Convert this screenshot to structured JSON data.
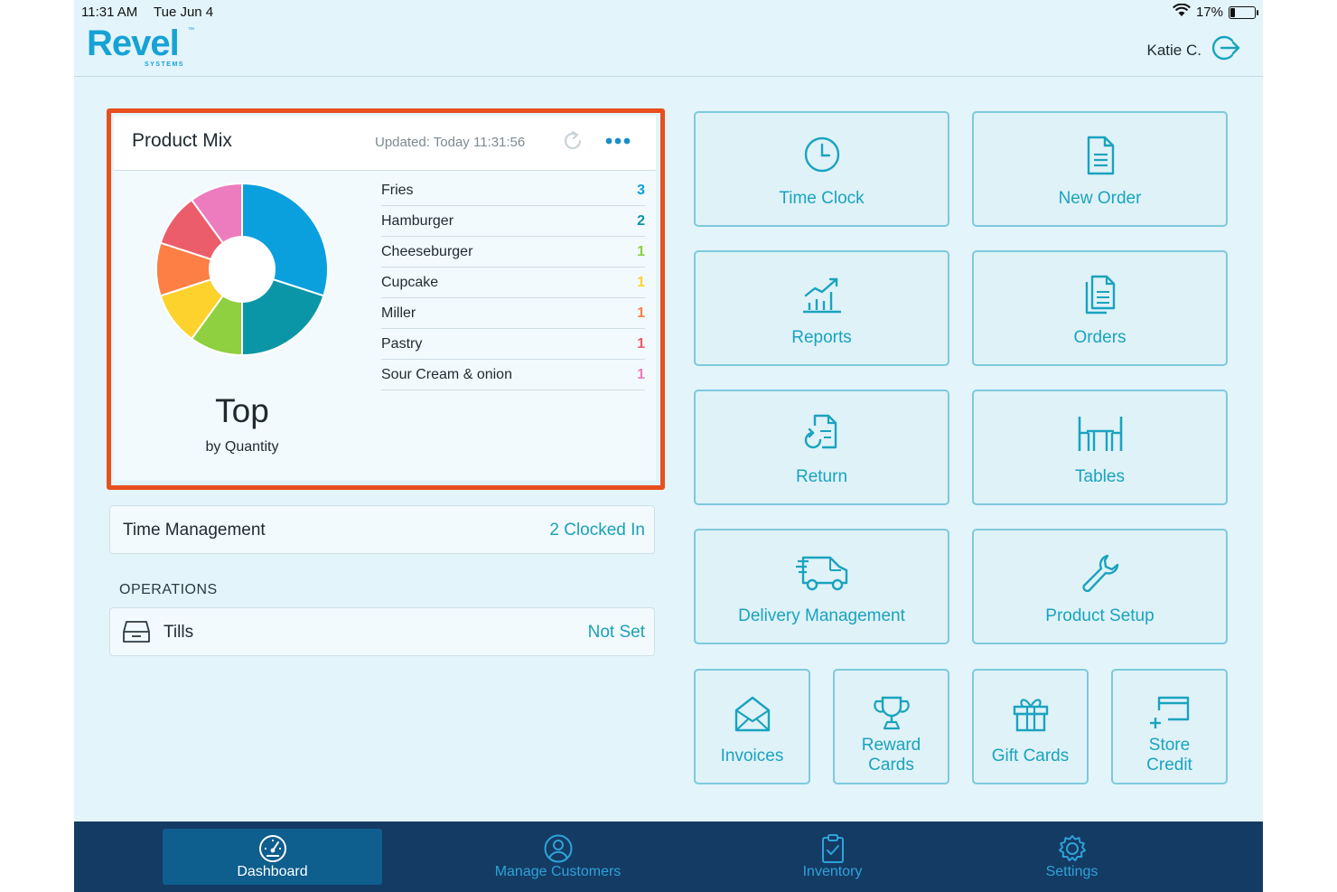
{
  "status_bar": {
    "time": "11:31 AM",
    "date": "Tue Jun 4",
    "battery": "17%",
    "battery_level": 0.17
  },
  "header": {
    "logo": "Revel",
    "logo_tm": "™",
    "logo_sub": "SYSTEMS",
    "user_name": "Katie C.",
    "logout_icon": "logout-icon"
  },
  "product_mix": {
    "title": "Product Mix",
    "updated": "Updated: Today 11:31:56",
    "top_label": "Top",
    "top_sub": "by Quantity",
    "items": [
      {
        "name": "Fries",
        "qty": "3",
        "color": "#0aa0de"
      },
      {
        "name": "Hamburger",
        "qty": "2",
        "color": "#0a96a6"
      },
      {
        "name": "Cheeseburger",
        "qty": "1",
        "color": "#8ed03f"
      },
      {
        "name": "Cupcake",
        "qty": "1",
        "color": "#fdd22c"
      },
      {
        "name": "Miller",
        "qty": "1",
        "color": "#fd7f45"
      },
      {
        "name": "Pastry",
        "qty": "1",
        "color": "#ec5d6b"
      },
      {
        "name": "Sour Cream & onion",
        "qty": "1",
        "color": "#ec7cbd"
      }
    ]
  },
  "time_management": {
    "label": "Time Management",
    "value": "2 Clocked In"
  },
  "operations": {
    "label": "OPERATIONS",
    "tills_label": "Tills",
    "tills_value": "Not Set"
  },
  "tiles": {
    "time_clock": "Time Clock",
    "new_order": "New Order",
    "reports": "Reports",
    "orders": "Orders",
    "return": "Return",
    "tables": "Tables",
    "delivery": "Delivery Management",
    "product_setup": "Product Setup",
    "invoices": "Invoices",
    "reward_1": "Reward",
    "reward_2": "Cards",
    "gift_cards": "Gift Cards",
    "store_1": "Store",
    "store_2": "Credit"
  },
  "nav": {
    "dashboard": "Dashboard",
    "manage_customers": "Manage Customers",
    "inventory": "Inventory",
    "settings": "Settings"
  },
  "colors": {
    "accent": "#1aa3bf",
    "highlight": "#e8501d",
    "navbar": "#143b64"
  }
}
